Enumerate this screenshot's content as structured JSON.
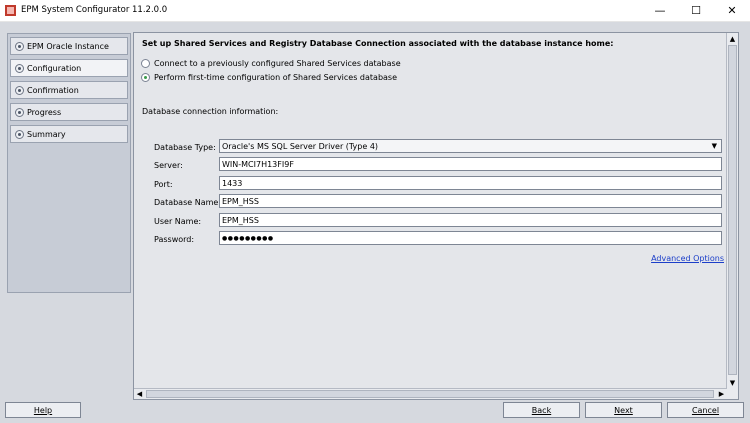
{
  "window": {
    "title": "EPM System Configurator 11.2.0.0",
    "minimize": "—",
    "maximize": "☐",
    "close": "✕"
  },
  "nav": {
    "items": [
      {
        "label": "EPM Oracle Instance"
      },
      {
        "label": "Configuration"
      },
      {
        "label": "Confirmation"
      },
      {
        "label": "Progress"
      },
      {
        "label": "Summary"
      }
    ],
    "active_index": 1
  },
  "panel": {
    "heading": "Set up Shared Services and Registry Database Connection associated with the database instance home:",
    "radio_options": [
      {
        "label": "Connect to a previously configured Shared Services database",
        "selected": false
      },
      {
        "label": "Perform first-time configuration of Shared Services database",
        "selected": true
      }
    ],
    "section_label": "Database connection information:",
    "fields": {
      "database_type": {
        "label": "Database Type:",
        "value": "Oracle's MS SQL Server Driver (Type 4)"
      },
      "server": {
        "label": "Server:",
        "value": "WIN-MCI7H13FI9F"
      },
      "port": {
        "label": "Port:",
        "value": "1433"
      },
      "database_name": {
        "label": "Database Name:",
        "value": "EPM_HSS"
      },
      "user_name": {
        "label": "User Name:",
        "value": "EPM_HSS"
      },
      "password": {
        "label": "Password:",
        "value": "●●●●●●●●●"
      }
    },
    "advanced_link": "Advanced Options"
  },
  "buttons": {
    "help": "Help",
    "back": "Back",
    "next": "Next",
    "cancel": "Cancel"
  },
  "colors": {
    "window_bg": "#d6d9df",
    "panel_bg": "#e4e6ea",
    "link": "#1b3ec9",
    "radio_selected": "#3a9a4b"
  }
}
